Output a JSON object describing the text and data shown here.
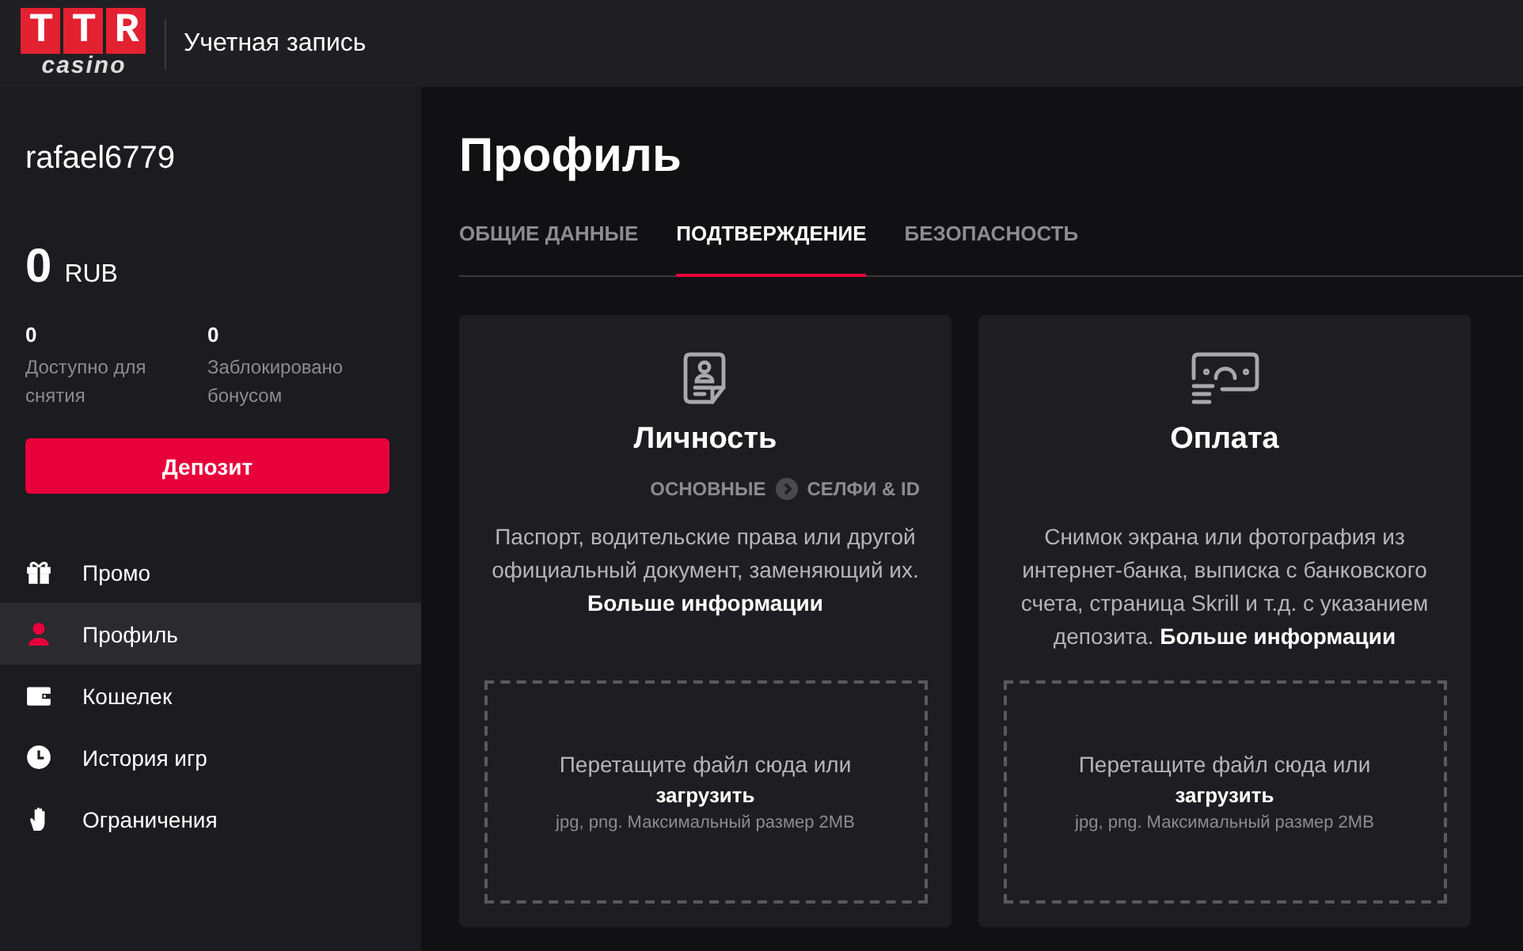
{
  "header": {
    "logo": {
      "letters": "TTR",
      "sub": "casino"
    },
    "title": "Учетная запись"
  },
  "sidebar": {
    "username": "rafael6779",
    "balance": {
      "amount": "0",
      "currency": "RUB"
    },
    "stats": [
      {
        "value": "0",
        "label": "Доступно для снятия"
      },
      {
        "value": "0",
        "label": "Заблокировано бонусом"
      }
    ],
    "deposit_button": "Депозит",
    "items": [
      {
        "kind": "gift",
        "label": "Промо",
        "selected": false
      },
      {
        "kind": "person",
        "label": "Профиль",
        "selected": true
      },
      {
        "kind": "wallet",
        "label": "Кошелек",
        "selected": false
      },
      {
        "kind": "clock",
        "label": "История игр",
        "selected": false
      },
      {
        "kind": "hand",
        "label": "Ограничения",
        "selected": false
      }
    ]
  },
  "main": {
    "title": "Профиль",
    "tabs": [
      {
        "label": "ОБЩИЕ ДАННЫЕ",
        "selected": false
      },
      {
        "label": "ПОДТВЕРЖДЕНИЕ",
        "selected": true
      },
      {
        "label": "БЕЗОПАСНОСТЬ",
        "selected": false
      }
    ],
    "cards": [
      {
        "kind": "identity",
        "title": "Личность",
        "steps": [
          "ОСНОВНЫЕ",
          "СЕЛФИ & ID"
        ],
        "description": "Паспорт, водительские права или другой официальный документ, заменяющий их.",
        "link": "Больше информации",
        "upload": {
          "text": "Перетащите файл сюда или",
          "link": "загрузить",
          "hint": "jpg, png. Максимальный размер 2MB"
        }
      },
      {
        "kind": "payment",
        "title": "Оплата",
        "description": "Снимок экрана или фотография из интернет-банка, выписка с банковского счета, страница Skrill и т.д. с указанием депозита.",
        "link": "Больше информации",
        "upload": {
          "text": "Перетащите файл сюда или",
          "link": "загрузить",
          "hint": "jpg, png. Максимальный размер 2MB"
        }
      }
    ]
  }
}
